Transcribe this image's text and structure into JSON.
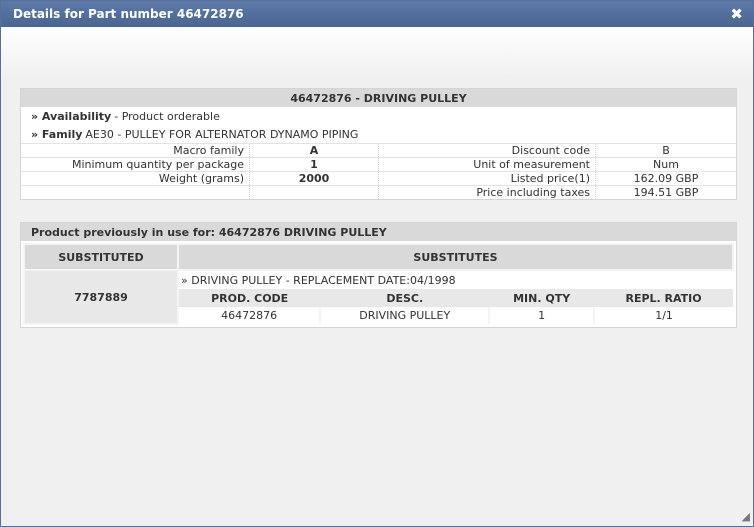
{
  "dialog": {
    "title": "Details for Part number 46472876",
    "close_glyph": "✖"
  },
  "details": {
    "header": "46472876 - DRIVING PULLEY",
    "availability_label": "» Availability",
    "availability_value": "- Product orderable",
    "family_label": "» Family",
    "family_value": "AE30 - PULLEY FOR ALTERNATOR DYNAMO PIPING",
    "rows": [
      {
        "l1": "Macro family",
        "v1": "A",
        "l2": "Discount code",
        "v2": "B"
      },
      {
        "l1": "Minimum quantity per package",
        "v1": "1",
        "l2": "Unit of measurement",
        "v2": "Num"
      },
      {
        "l1": "Weight (grams)",
        "v1": "2000",
        "l2": "Listed price(1)",
        "v2": "162.09 GBP"
      },
      {
        "l1": "",
        "v1": "",
        "l2": "Price including taxes",
        "v2": "194.51 GBP"
      }
    ]
  },
  "substitution": {
    "header": "Product previously in use for: 46472876 DRIVING PULLEY",
    "col_substituted": "SUBSTITUTED",
    "col_substitutes": "SUBSTITUTES",
    "substituted_code": "7787889",
    "replacement_line": "» DRIVING PULLEY - REPLACEMENT DATE:04/1998",
    "sub_headers": [
      "PROD. CODE",
      "DESC.",
      "MIN. QTY",
      "REPL. RATIO"
    ],
    "sub_row": [
      "46472876",
      "DRIVING PULLEY",
      "1",
      "1/1"
    ]
  }
}
